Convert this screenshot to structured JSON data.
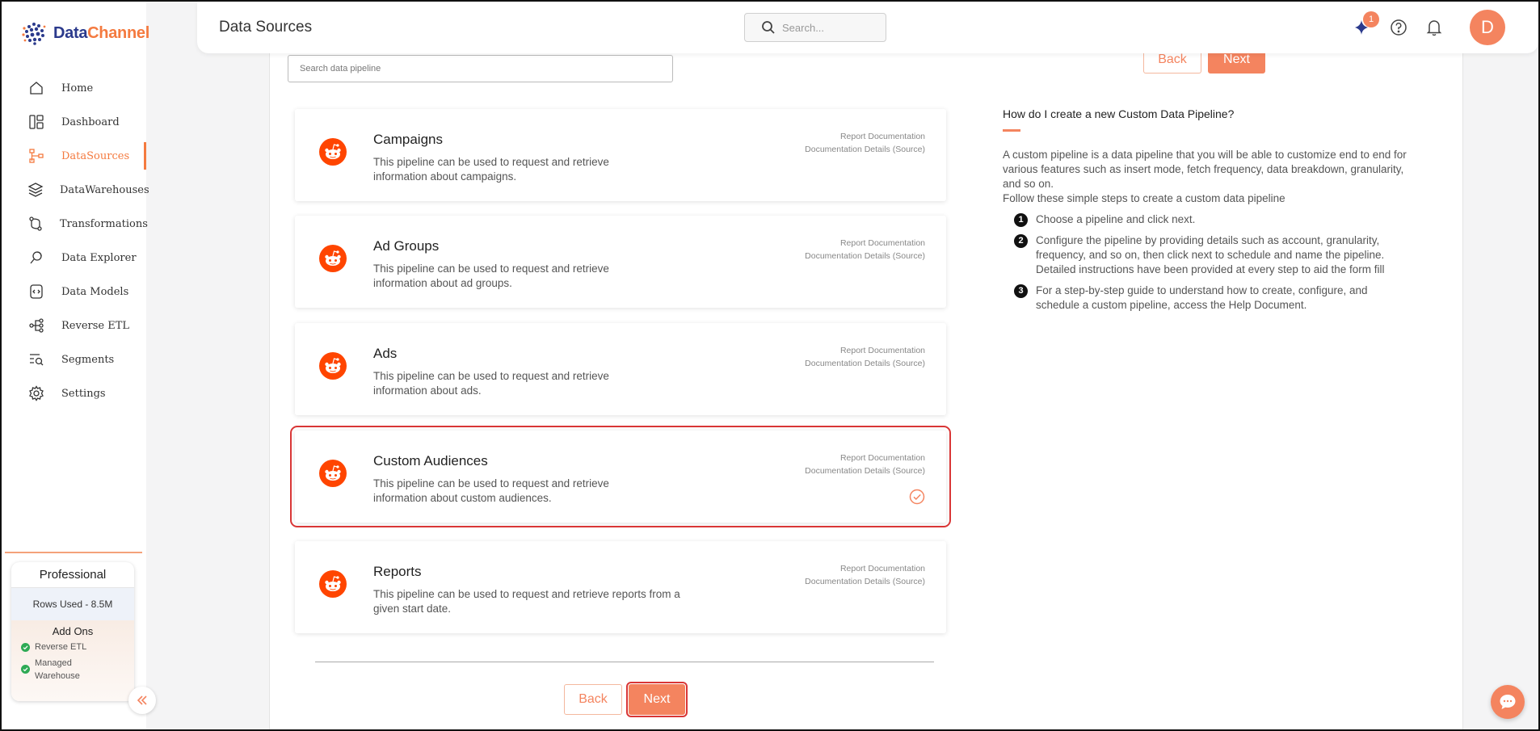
{
  "brand": {
    "name_part1": "Data",
    "name_part2": "Channel",
    "accent": "#f4845f",
    "primary": "#2b3a8c"
  },
  "header": {
    "title": "Data Sources",
    "search_placeholder": "Search...",
    "notification_count": "1",
    "avatar_initial": "D"
  },
  "sidebar": {
    "items": [
      {
        "label": "Home",
        "icon": "home-icon",
        "active": false
      },
      {
        "label": "Dashboard",
        "icon": "dashboard-icon",
        "active": false
      },
      {
        "label": "DataSources",
        "icon": "datasources-icon",
        "active": true
      },
      {
        "label": "DataWarehouses",
        "icon": "layers-icon",
        "active": false
      },
      {
        "label": "Transformations",
        "icon": "transform-icon",
        "active": false
      },
      {
        "label": "Data Explorer",
        "icon": "explorer-icon",
        "active": false
      },
      {
        "label": "Data Models",
        "icon": "data-model-icon",
        "active": false
      },
      {
        "label": "Reverse ETL",
        "icon": "reverse-etl-icon",
        "active": false
      },
      {
        "label": "Segments",
        "icon": "segments-icon",
        "active": false
      },
      {
        "label": "Settings",
        "icon": "gear-icon",
        "active": false
      }
    ],
    "plan": {
      "title": "Professional",
      "rows_used": "Rows Used - 8.5M",
      "addons_title": "Add Ons",
      "addons": [
        "Reverse ETL",
        "Managed Warehouse"
      ]
    }
  },
  "main": {
    "search_placeholder": "Search data pipeline",
    "back_label": "Back",
    "next_label": "Next",
    "cards": [
      {
        "title": "Campaigns",
        "desc": "This pipeline can be used to request and retrieve information about campaigns.",
        "link1": "Report Documentation",
        "link2": "Documentation Details (Source)",
        "selected": false
      },
      {
        "title": "Ad Groups",
        "desc": "This pipeline can be used to request and retrieve information about ad groups.",
        "link1": "Report Documentation",
        "link2": "Documentation Details (Source)",
        "selected": false
      },
      {
        "title": "Ads",
        "desc": "This pipeline can be used to request and retrieve information about ads.",
        "link1": "Report Documentation",
        "link2": "Documentation Details (Source)",
        "selected": false
      },
      {
        "title": "Custom Audiences",
        "desc": "This pipeline can be used to request and retrieve information about custom audiences.",
        "link1": "Report Documentation",
        "link2": "Documentation Details (Source)",
        "selected": true
      },
      {
        "title": "Reports",
        "desc": "This pipeline can be used to request and retrieve reports from a given start date.",
        "link1": "Report Documentation",
        "link2": "Documentation Details (Source)",
        "selected": false
      }
    ]
  },
  "help": {
    "title": "How do I create a new Custom Data Pipeline?",
    "intro": "A custom pipeline is a data pipeline that you will be able to customize end to end for various features such as insert mode, fetch frequency, data breakdown, granularity, and so on.",
    "follow": "Follow these simple steps to create a custom data pipeline",
    "steps": [
      {
        "num": "1",
        "text": "Choose a pipeline and click next."
      },
      {
        "num": "2",
        "text": "Configure the pipeline by providing details such as account, granularity, frequency, and so on, then click next to schedule and name the pipeline. Detailed instructions have been provided at every step to aid the form fill"
      },
      {
        "num": "3",
        "text": "For a step-by-step guide to understand how to create, configure, and schedule a custom pipeline, access the Help Document."
      }
    ]
  }
}
